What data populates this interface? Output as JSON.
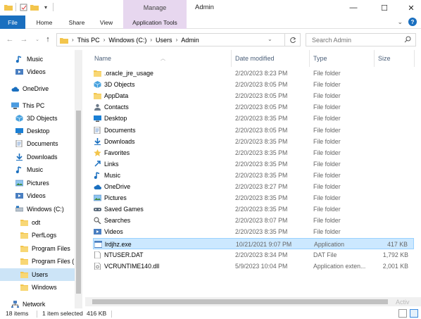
{
  "quick_access": {
    "undo_hint": "▾"
  },
  "ribbon": {
    "context_tab_header": "Manage",
    "window_title": "Admin",
    "tabs": [
      "File",
      "Home",
      "Share",
      "View",
      "Application Tools"
    ]
  },
  "window_controls": {
    "minimize": "—",
    "maximize": "☐",
    "close": "✕"
  },
  "address": {
    "crumbs": [
      "This PC",
      "Windows (C:)",
      "Users",
      "Admin"
    ],
    "search_placeholder": "Search Admin"
  },
  "nav_items": [
    {
      "label": "Music",
      "icon": "music-icon",
      "indent": 22
    },
    {
      "label": "Videos",
      "icon": "video-icon",
      "indent": 22
    },
    {
      "label": "OneDrive",
      "icon": "cloud-icon",
      "indent": 16
    },
    {
      "label": "This PC",
      "icon": "pc-icon",
      "indent": 16
    },
    {
      "label": "3D Objects",
      "icon": "3d-icon",
      "indent": 22
    },
    {
      "label": "Desktop",
      "icon": "desktop-icon",
      "indent": 22
    },
    {
      "label": "Documents",
      "icon": "documents-icon",
      "indent": 22
    },
    {
      "label": "Downloads",
      "icon": "download-icon",
      "indent": 22
    },
    {
      "label": "Music",
      "icon": "music-icon",
      "indent": 22
    },
    {
      "label": "Pictures",
      "icon": "pictures-icon",
      "indent": 22
    },
    {
      "label": "Videos",
      "icon": "video-icon",
      "indent": 22
    },
    {
      "label": "Windows (C:)",
      "icon": "drive-icon",
      "indent": 22
    },
    {
      "label": "odt",
      "icon": "folder-icon",
      "indent": 29
    },
    {
      "label": "PerfLogs",
      "icon": "folder-icon",
      "indent": 29
    },
    {
      "label": "Program Files",
      "icon": "folder-icon",
      "indent": 29
    },
    {
      "label": "Program Files (",
      "icon": "folder-icon",
      "indent": 29
    },
    {
      "label": "Users",
      "icon": "folder-icon",
      "indent": 29,
      "selected": true
    },
    {
      "label": "Windows",
      "icon": "folder-icon",
      "indent": 29
    },
    {
      "label": "Network",
      "icon": "network-icon",
      "indent": 16
    }
  ],
  "columns": {
    "name": "Name",
    "date": "Date modified",
    "type": "Type",
    "size": "Size"
  },
  "files": [
    {
      "name": ".oracle_jre_usage",
      "date": "2/20/2023 8:23 PM",
      "type": "File folder",
      "size": "",
      "icon": "folder-icon"
    },
    {
      "name": "3D Objects",
      "date": "2/20/2023 8:05 PM",
      "type": "File folder",
      "size": "",
      "icon": "3d-icon"
    },
    {
      "name": "AppData",
      "date": "2/20/2023 8:05 PM",
      "type": "File folder",
      "size": "",
      "icon": "folder-icon"
    },
    {
      "name": "Contacts",
      "date": "2/20/2023 8:05 PM",
      "type": "File folder",
      "size": "",
      "icon": "contacts-icon"
    },
    {
      "name": "Desktop",
      "date": "2/20/2023 8:35 PM",
      "type": "File folder",
      "size": "",
      "icon": "desktop-icon"
    },
    {
      "name": "Documents",
      "date": "2/20/2023 8:05 PM",
      "type": "File folder",
      "size": "",
      "icon": "documents-icon"
    },
    {
      "name": "Downloads",
      "date": "2/20/2023 8:35 PM",
      "type": "File folder",
      "size": "",
      "icon": "download-icon"
    },
    {
      "name": "Favorites",
      "date": "2/20/2023 8:35 PM",
      "type": "File folder",
      "size": "",
      "icon": "star-icon"
    },
    {
      "name": "Links",
      "date": "2/20/2023 8:35 PM",
      "type": "File folder",
      "size": "",
      "icon": "link-icon"
    },
    {
      "name": "Music",
      "date": "2/20/2023 8:35 PM",
      "type": "File folder",
      "size": "",
      "icon": "music-icon"
    },
    {
      "name": "OneDrive",
      "date": "2/20/2023 8:27 PM",
      "type": "File folder",
      "size": "",
      "icon": "cloud-icon"
    },
    {
      "name": "Pictures",
      "date": "2/20/2023 8:35 PM",
      "type": "File folder",
      "size": "",
      "icon": "pictures-icon"
    },
    {
      "name": "Saved Games",
      "date": "2/20/2023 8:35 PM",
      "type": "File folder",
      "size": "",
      "icon": "saved-games-icon"
    },
    {
      "name": "Searches",
      "date": "2/20/2023 8:07 PM",
      "type": "File folder",
      "size": "",
      "icon": "search-icon"
    },
    {
      "name": "Videos",
      "date": "2/20/2023 8:35 PM",
      "type": "File folder",
      "size": "",
      "icon": "video-icon"
    },
    {
      "name": "lrdjhz.exe",
      "date": "10/21/2021 9:07 PM",
      "type": "Application",
      "size": "417 KB",
      "icon": "app-icon",
      "selected": true
    },
    {
      "name": "NTUSER.DAT",
      "date": "2/20/2023 8:34 PM",
      "type": "DAT File",
      "size": "1,792 KB",
      "icon": "file-icon"
    },
    {
      "name": "VCRUNTIME140.dll",
      "date": "5/9/2023 10:04 PM",
      "type": "Application exten...",
      "size": "2,001 KB",
      "icon": "dll-icon"
    }
  ],
  "status": {
    "items": "18 items",
    "selected": "1 item selected",
    "size": "416 KB"
  },
  "watermark": "Activ",
  "colors": {
    "accent": "#1a6fbf",
    "context_tab": "#e7d7ef",
    "selection": "#cce8ff",
    "folder": "#f3c54c"
  }
}
